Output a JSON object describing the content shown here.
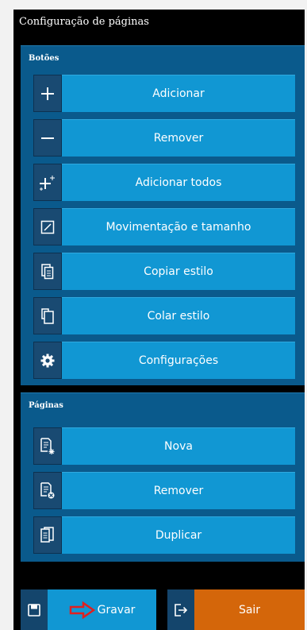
{
  "title": "Configuração de páginas",
  "buttons_group": {
    "label": "Botões",
    "items": [
      {
        "label": "Adicionar",
        "icon": "plus-icon"
      },
      {
        "label": "Remover",
        "icon": "minus-icon"
      },
      {
        "label": "Adicionar todos",
        "icon": "plus-all-icon"
      },
      {
        "label": "Movimentação e tamanho",
        "icon": "resize-icon"
      },
      {
        "label": "Copiar estilo",
        "icon": "copy-icon"
      },
      {
        "label": "Colar estilo",
        "icon": "paste-icon"
      },
      {
        "label": "Configurações",
        "icon": "gear-icon"
      }
    ]
  },
  "pages_group": {
    "label": "Páginas",
    "items": [
      {
        "label": "Nova",
        "icon": "new-page-icon"
      },
      {
        "label": "Remover",
        "icon": "remove-page-icon"
      },
      {
        "label": "Duplicar",
        "icon": "duplicate-page-icon"
      }
    ]
  },
  "footer": {
    "save_label": "Gravar",
    "exit_label": "Sair"
  },
  "colors": {
    "button_blue": "#1197d3",
    "icon_dark": "#194a72",
    "group_bg": "#0a5a8c",
    "exit_orange": "#d4660a",
    "arrow_red": "#e02020"
  }
}
